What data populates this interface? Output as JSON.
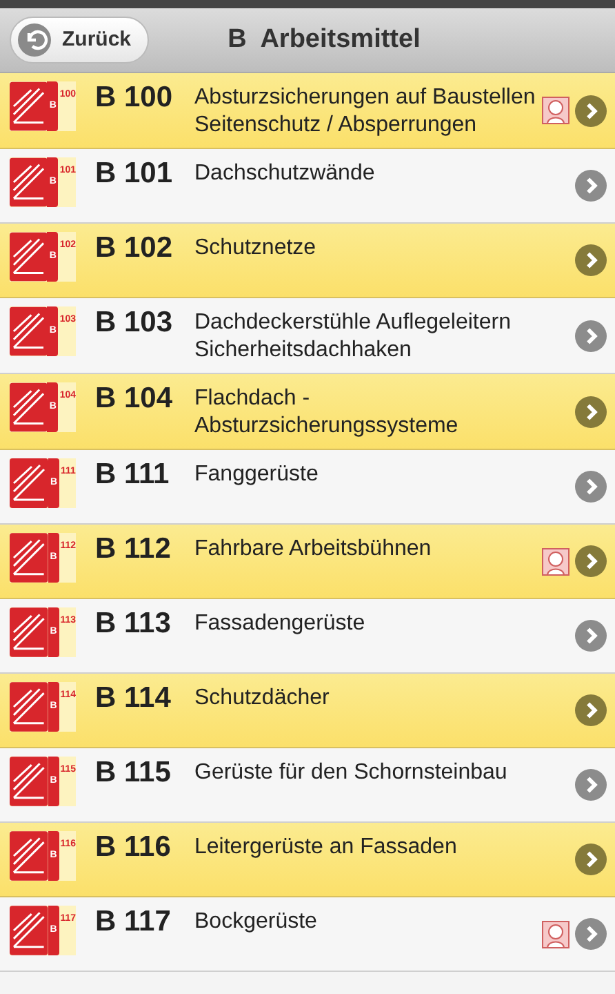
{
  "header": {
    "back_button": "Zurück",
    "title": "B  Arbeitsmittel"
  },
  "rows": [
    {
      "letter": "B",
      "number": "100",
      "code": "B 100",
      "text": "Absturzsicherungen auf Baustellen Seitenschutz / Absperrungen",
      "highlighted": true,
      "extra_icon": true
    },
    {
      "letter": "B",
      "number": "101",
      "code": "B 101",
      "text": "Dachschutzwände",
      "highlighted": false,
      "extra_icon": false
    },
    {
      "letter": "B",
      "number": "102",
      "code": "B 102",
      "text": "Schutznetze",
      "highlighted": true,
      "extra_icon": false
    },
    {
      "letter": "B",
      "number": "103",
      "code": "B 103",
      "text": "Dachdeckerstühle Auflegeleitern Sicherheitsdachhaken",
      "highlighted": false,
      "extra_icon": false
    },
    {
      "letter": "B",
      "number": "104",
      "code": "B 104",
      "text": "Flachdach - Absturzsicherungssysteme",
      "highlighted": true,
      "extra_icon": false
    },
    {
      "letter": "B",
      "number": "111",
      "code": "B 111",
      "text": "Fanggerüste",
      "highlighted": false,
      "extra_icon": false
    },
    {
      "letter": "B",
      "number": "112",
      "code": "B 112",
      "text": "Fahrbare Arbeitsbühnen",
      "highlighted": true,
      "extra_icon": true
    },
    {
      "letter": "B",
      "number": "113",
      "code": "B 113",
      "text": "Fassadengerüste",
      "highlighted": false,
      "extra_icon": false
    },
    {
      "letter": "B",
      "number": "114",
      "code": "B 114",
      "text": "Schutzdächer",
      "highlighted": true,
      "extra_icon": false
    },
    {
      "letter": "B",
      "number": "115",
      "code": "B 115",
      "text": "Gerüste für den Schornsteinbau",
      "highlighted": false,
      "extra_icon": false
    },
    {
      "letter": "B",
      "number": "116",
      "code": "B 116",
      "text": "Leitergerüste an Fassaden",
      "highlighted": true,
      "extra_icon": false
    },
    {
      "letter": "B",
      "number": "117",
      "code": "B 117",
      "text": "Bockgerüste",
      "highlighted": false,
      "extra_icon": true
    }
  ]
}
